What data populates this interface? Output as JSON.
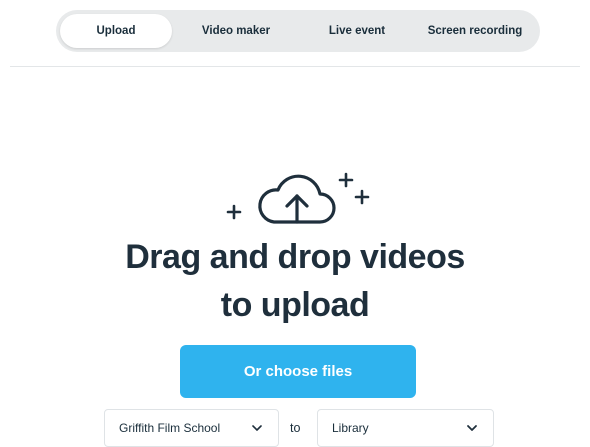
{
  "tabs": [
    "Upload",
    "Video maker",
    "Live event",
    "Screen recording"
  ],
  "active_tab": "Upload",
  "upload": {
    "icon": "cloud-upload-icon",
    "headline_line1": "Drag and drop videos",
    "headline_line2": "to upload",
    "choose_button": "Or choose files"
  },
  "destination": {
    "team": "Griffith Film School",
    "connector": "to",
    "folder": "Library"
  },
  "colors": {
    "accent": "#2fb3ee",
    "text": "#1f2f3c",
    "tab_bg": "#e8eaeb"
  }
}
